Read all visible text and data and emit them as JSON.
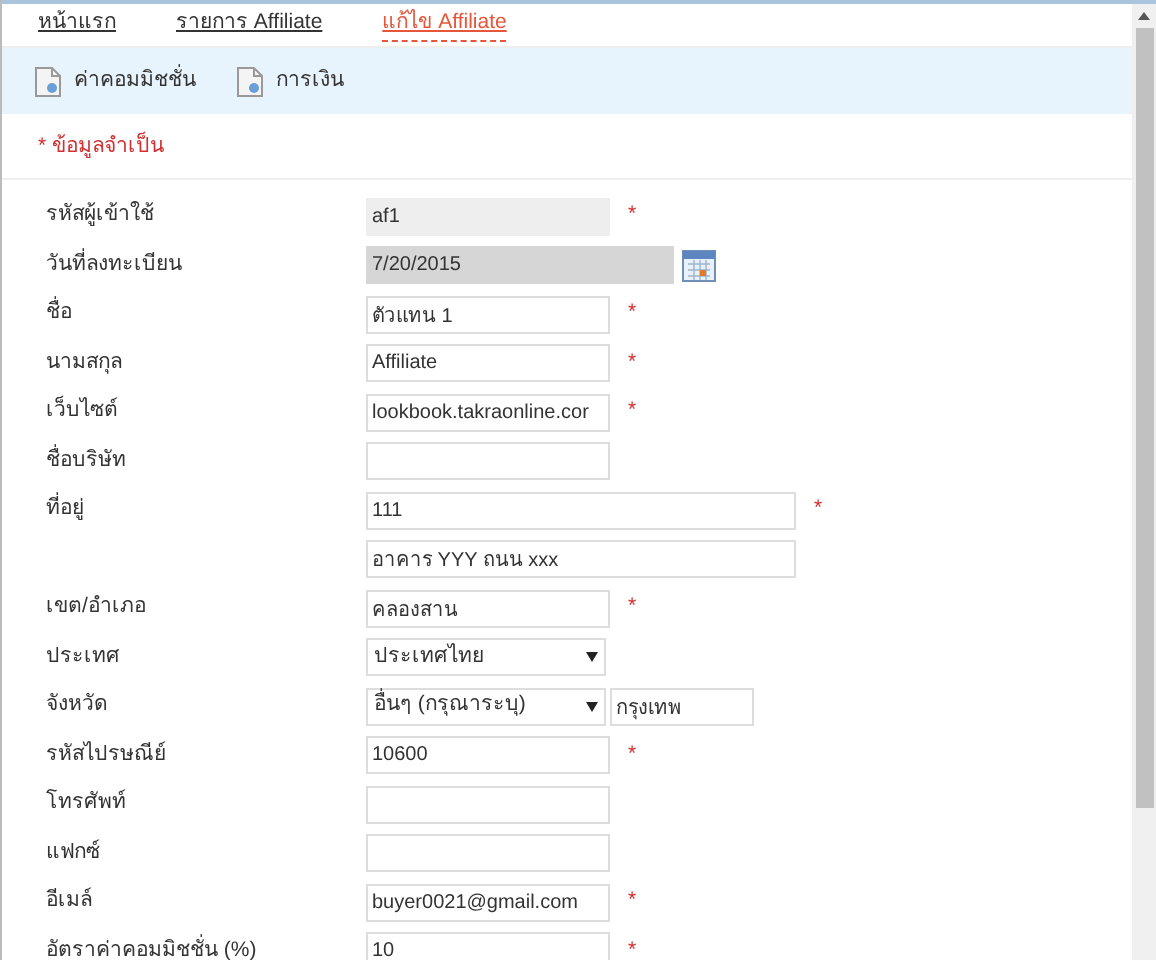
{
  "breadcrumb": [
    {
      "label": "หน้าแรก",
      "selected": false
    },
    {
      "label": "รายการ Affiliate",
      "selected": false
    },
    {
      "label": "แก้ไข Affiliate",
      "selected": true
    }
  ],
  "toolbar": [
    "ค่าคอมมิชชั่น",
    "การเงิน"
  ],
  "required_note": "* ข้อมูลจำเป็น",
  "fields": [
    {
      "label": "รหัสผู้เข้าใช้",
      "required_mark": "*",
      "inputs": [
        {
          "kind": "readonly",
          "value": "af1"
        }
      ]
    },
    {
      "label": "วันที่ลงทะเบียน",
      "inputs": [
        {
          "kind": "date",
          "value": "7/20/2015"
        }
      ]
    },
    {
      "label": "ชื่อ",
      "required_mark": "*",
      "inputs": [
        {
          "kind": "text",
          "value": "ตัวแทน 1"
        }
      ]
    },
    {
      "label": "นามสกุล",
      "required_mark": "*",
      "inputs": [
        {
          "kind": "text",
          "value": "Affiliate"
        }
      ]
    },
    {
      "label": "เว็บไซต์",
      "required_mark": "*",
      "inputs": [
        {
          "kind": "text",
          "value": "lookbook.takraonline.cor"
        }
      ]
    },
    {
      "label": "ชื่อบริษัท",
      "inputs": [
        {
          "kind": "text"
        }
      ]
    },
    {
      "label": "ที่อยู่",
      "required_mark": "*",
      "inputs": [
        {
          "kind": "long",
          "value": "111"
        }
      ]
    },
    {
      "inputs": [
        {
          "kind": "long",
          "value": "อาคาร YYY ถนน xxx"
        }
      ]
    },
    {
      "label": "เขต/อำเภอ",
      "required_mark": "*",
      "inputs": [
        {
          "kind": "text",
          "value": "คลองสาน"
        }
      ]
    },
    {
      "label": "ประเทศ",
      "inputs": [
        {
          "kind": "select",
          "value": "ประเทศไทย"
        }
      ]
    },
    {
      "label": "จังหวัด",
      "inputs": [
        {
          "kind": "select",
          "value": "อื่นๆ (กรุณาระบุ)"
        },
        {
          "kind": "short",
          "value": "กรุงเทพ"
        }
      ]
    },
    {
      "label": "รหัสไปรษณีย์",
      "required_mark": "*",
      "inputs": [
        {
          "kind": "text",
          "value": "10600"
        }
      ]
    },
    {
      "label": "โทรศัพท์",
      "inputs": [
        {
          "kind": "text"
        }
      ]
    },
    {
      "label": "แฟกซ์",
      "inputs": [
        {
          "kind": "text"
        }
      ]
    },
    {
      "label": "อีเมล์",
      "required_mark": "*",
      "inputs": [
        {
          "kind": "text",
          "value": "buyer0021@gmail.com"
        }
      ]
    },
    {
      "label": "อัตราค่าคอมมิชชั่น (%)",
      "required_mark": "*",
      "inputs": [
        {
          "kind": "text",
          "value": "10"
        }
      ]
    }
  ]
}
